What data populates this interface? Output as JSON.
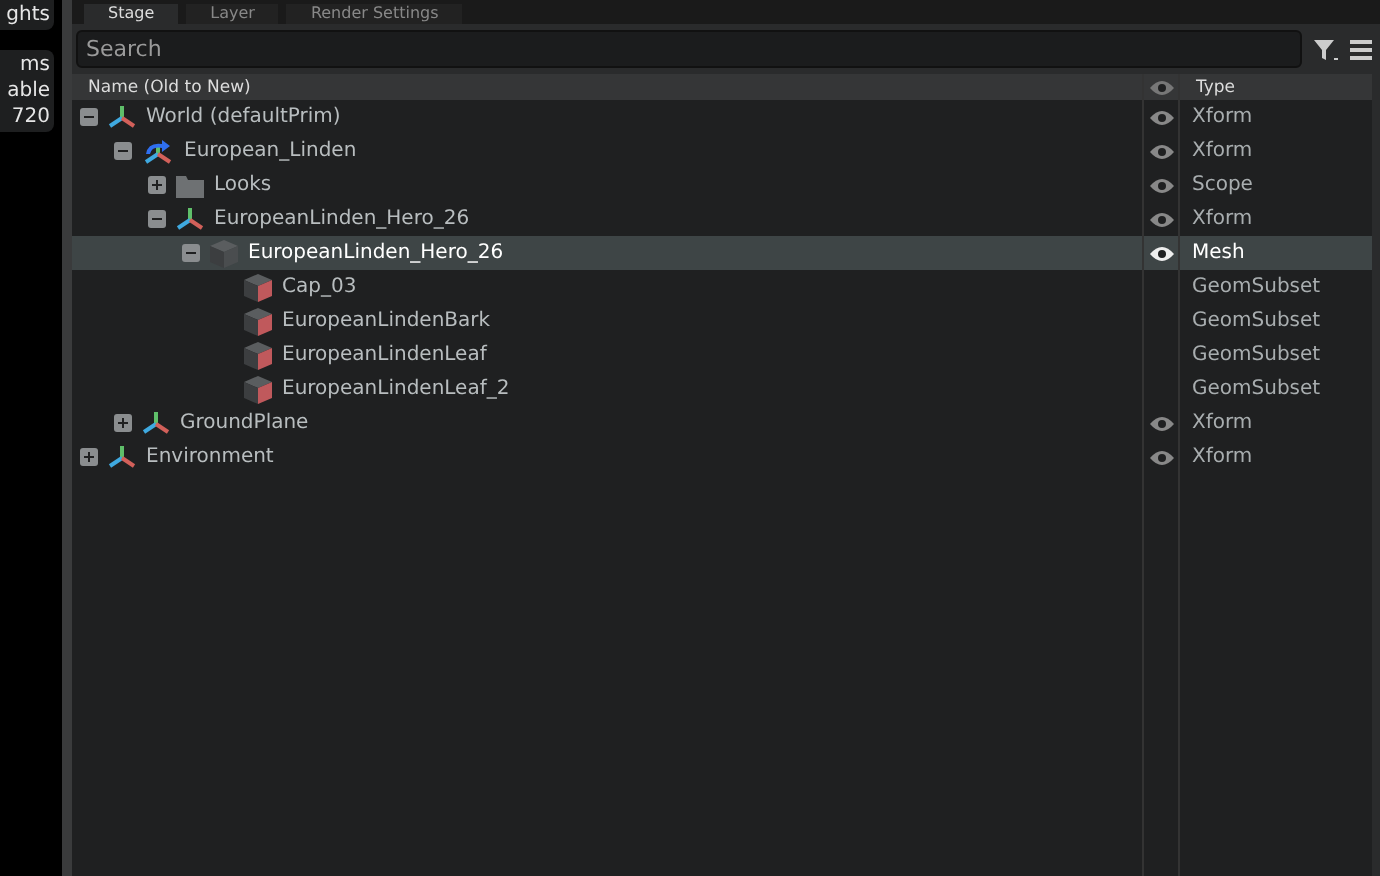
{
  "side_panel": {
    "top_label": "ghts",
    "lines": [
      "ms",
      "able",
      "720"
    ]
  },
  "tabs": [
    {
      "label": "Stage",
      "selected": true
    },
    {
      "label": "Layer",
      "selected": false
    },
    {
      "label": "Render Settings",
      "selected": false
    }
  ],
  "search": {
    "placeholder": "Search"
  },
  "columns": {
    "name": "Name (Old to New)",
    "type": "Type"
  },
  "tree": [
    {
      "name": "World (defaultPrim)",
      "kind": "xform",
      "type": "Xform",
      "visible": true,
      "expanded": true,
      "selected": false,
      "children": [
        {
          "name": "European_Linden",
          "kind": "xform-animated",
          "type": "Xform",
          "visible": true,
          "expanded": true,
          "selected": false,
          "children": [
            {
              "name": "Looks",
              "kind": "folder",
              "type": "Scope",
              "visible": true,
              "expanded": false,
              "selected": false
            },
            {
              "name": "EuropeanLinden_Hero_26",
              "kind": "xform",
              "type": "Xform",
              "visible": true,
              "expanded": true,
              "selected": false,
              "children": [
                {
                  "name": "EuropeanLinden_Hero_26",
                  "kind": "mesh",
                  "type": "Mesh",
                  "visible": true,
                  "expanded": true,
                  "selected": true,
                  "children": [
                    {
                      "name": "Cap_03",
                      "kind": "subset",
                      "type": "GeomSubset",
                      "visible": false,
                      "selected": false
                    },
                    {
                      "name": "EuropeanLindenBark",
                      "kind": "subset",
                      "type": "GeomSubset",
                      "visible": false,
                      "selected": false
                    },
                    {
                      "name": "EuropeanLindenLeaf",
                      "kind": "subset",
                      "type": "GeomSubset",
                      "visible": false,
                      "selected": false
                    },
                    {
                      "name": "EuropeanLindenLeaf_2",
                      "kind": "subset",
                      "type": "GeomSubset",
                      "visible": false,
                      "selected": false
                    }
                  ]
                }
              ]
            }
          ]
        },
        {
          "name": "GroundPlane",
          "kind": "xform",
          "type": "Xform",
          "visible": true,
          "expanded": false,
          "selected": false
        }
      ]
    },
    {
      "name": "Environment",
      "kind": "xform",
      "type": "Xform",
      "visible": true,
      "expanded": false,
      "selected": false
    }
  ]
}
